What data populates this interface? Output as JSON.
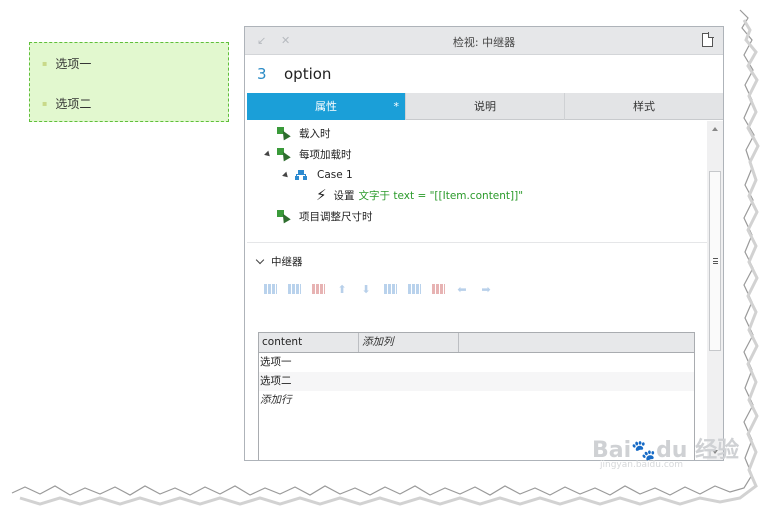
{
  "preview": {
    "items": [
      "选项一",
      "选项二"
    ]
  },
  "panel": {
    "title": "检视: 中继器",
    "minimize_glyph": "↙",
    "close_glyph": "✕",
    "component_number": "3",
    "component_name": "option",
    "tabs": [
      {
        "label": "属性",
        "active": true,
        "modified_marker": "*"
      },
      {
        "label": "说明",
        "active": false
      },
      {
        "label": "样式",
        "active": false
      }
    ],
    "events": {
      "on_load": "载入时",
      "on_item_load": "每项加载时",
      "case_label": "Case 1",
      "action_verb": "设置",
      "action_detail": "文字于 text = \"[[Item.content]]\"",
      "on_item_resize": "项目调整尺寸时"
    },
    "repeater_section": {
      "title": "中继器",
      "table": {
        "columns": [
          "content",
          "添加列"
        ],
        "rows": [
          "选项一",
          "选项二"
        ],
        "add_row_label": "添加行"
      }
    },
    "toolbar_icons": [
      "insert-row-above-icon",
      "insert-row-below-icon",
      "delete-row-icon",
      "move-up-icon",
      "move-down-icon",
      "insert-column-left-icon",
      "insert-column-right-icon",
      "delete-column-icon",
      "move-left-icon",
      "move-right-icon"
    ]
  },
  "watermark": {
    "brand": "Bai",
    "brand_suffix": "du",
    "product": "经验",
    "url": "jingyan.baidu.com"
  },
  "colors": {
    "accent": "#1b9fd8",
    "preview_bg": "#e2f8cf",
    "preview_border": "#5fbf3a",
    "action_text": "#2a9a2a",
    "number_text": "#2a8bc6"
  }
}
